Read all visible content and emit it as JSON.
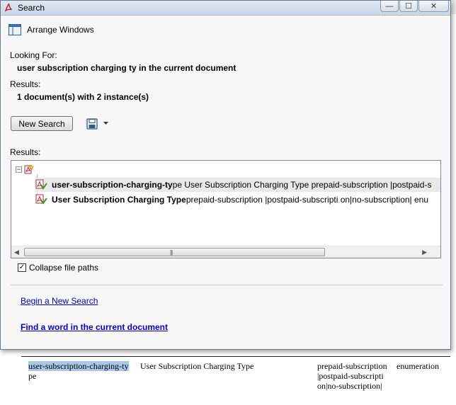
{
  "window": {
    "title": "Search",
    "buttons": {
      "minimize": "—",
      "maximize": "☐",
      "close": "✕"
    }
  },
  "arrange": {
    "label": "Arrange Windows"
  },
  "looking_for": {
    "label": "Looking For:",
    "value": "user subscription charging ty in the current document"
  },
  "results_summary": {
    "label": "Results:",
    "value": "1 document(s) with 2 instance(s)"
  },
  "toolbar": {
    "new_search_label": "New Search",
    "save_icon": "save-icon",
    "dropdown_icon": "chevron-down-icon"
  },
  "results_list": {
    "label": "Results:",
    "root_expander": "⊟",
    "items": [
      {
        "match": "user-subscription-charging-ty",
        "context": " pe User Subscription Charging Type prepaid-subscription |postpaid-s",
        "selected": true
      },
      {
        "match": "User Subscription Charging Type",
        "context": " prepaid-subscription |postpaid-subscripti on|no-subscription| enu",
        "selected": false
      }
    ]
  },
  "collapse_paths": {
    "label": "Collapse file paths",
    "checked": true
  },
  "links": {
    "new_search": "Begin a New Search",
    "find_word": "Find a word in the current document"
  },
  "background_doc": {
    "cell1_line1": "user-subscription-charging-ty",
    "cell1_line2": "pe",
    "cell2": "User Subscription Charging Type",
    "cell3_line1": "prepaid-subscription",
    "cell3_line2": "|postpaid-subscripti",
    "cell3_line3": "on|no-subscription|",
    "cell4": "enumeration"
  }
}
